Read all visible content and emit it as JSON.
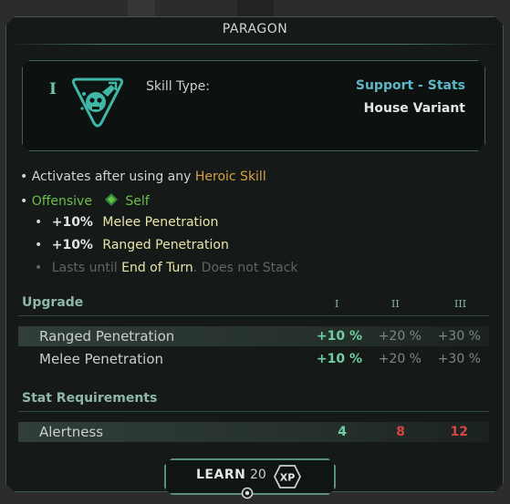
{
  "window": {
    "title": "PARAGON"
  },
  "skill": {
    "tier": "I",
    "icon": "wrench-skull-icon",
    "type_label": "Skill Type:",
    "type_value": "Support - Stats",
    "variant": "House Variant"
  },
  "description": {
    "activation_prefix": "• Activates after using any ",
    "activation_link": "Heroic Skill",
    "target_bullet": "• ",
    "target_offensive": "Offensive",
    "target_icon": "diamond-icon",
    "target_self": "Self",
    "effects": [
      {
        "bullet": "•",
        "value": "+10%",
        "stat": "Melee Penetration"
      },
      {
        "bullet": "•",
        "value": "+10%",
        "stat": "Ranged Penetration"
      }
    ],
    "duration_bullet": "•",
    "duration_prefix": "Lasts until ",
    "duration_end": "End of Turn",
    "duration_suffix": ". Does not Stack"
  },
  "upgrade": {
    "title": "Upgrade",
    "levels": [
      "I",
      "II",
      "III"
    ],
    "rows": [
      {
        "label": "Ranged Penetration",
        "values": [
          "+10 %",
          "+20 %",
          "+30 %"
        ]
      },
      {
        "label": "Melee Penetration",
        "values": [
          "+10 %",
          "+20 %",
          "+30 %"
        ]
      }
    ]
  },
  "requirements": {
    "title": "Stat Requirements",
    "rows": [
      {
        "label": "Alertness",
        "values": [
          "4",
          "8",
          "12"
        ]
      }
    ]
  },
  "learn": {
    "label": "LEARN",
    "cost": "20",
    "currency": "XP",
    "hint_icon": "target-icon"
  },
  "colors": {
    "accent": "#5a8c7f",
    "stat_value": "#6fcfa0",
    "requirement_unmet": "#d64545",
    "skill_link": "#d6a14a",
    "offensive": "#6bbf4c",
    "type_value": "#5eb7c6"
  }
}
